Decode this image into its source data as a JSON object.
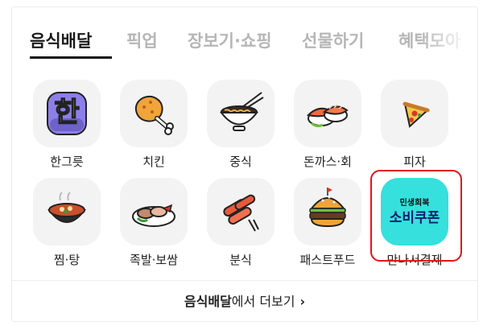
{
  "tabs": [
    {
      "label": "음식배달",
      "active": true
    },
    {
      "label": "픽업",
      "active": false
    },
    {
      "label": "장보기·쇼핑",
      "active": false
    },
    {
      "label": "선물하기",
      "active": false
    },
    {
      "label": "혜택모아",
      "active": false
    }
  ],
  "categories": [
    {
      "label": "한그릇",
      "icon": "han-bowl-icon"
    },
    {
      "label": "치킨",
      "icon": "chicken-icon"
    },
    {
      "label": "중식",
      "icon": "noodle-bowl-icon"
    },
    {
      "label": "돈까스·회",
      "icon": "sushi-icon"
    },
    {
      "label": "피자",
      "icon": "pizza-icon"
    },
    {
      "label": "찜·탕",
      "icon": "stew-pot-icon"
    },
    {
      "label": "족발·보쌈",
      "icon": "pork-platter-icon"
    },
    {
      "label": "분식",
      "icon": "tteokbokki-icon"
    },
    {
      "label": "패스트푸드",
      "icon": "burger-icon"
    },
    {
      "label": "만나서결제",
      "icon": "coupon-icon"
    }
  ],
  "coupon": {
    "top_text": "민생회복",
    "main_text": "소비쿠폰",
    "color": "#35e0dd"
  },
  "han_char": "한",
  "footer": {
    "bold": "음식배달",
    "rest": "에서 더보기",
    "chevron": "›"
  },
  "colors": {
    "highlight_border": "#e4141b",
    "active_tab": "#1a1a1a",
    "inactive_tab": "#b6b6b6"
  }
}
